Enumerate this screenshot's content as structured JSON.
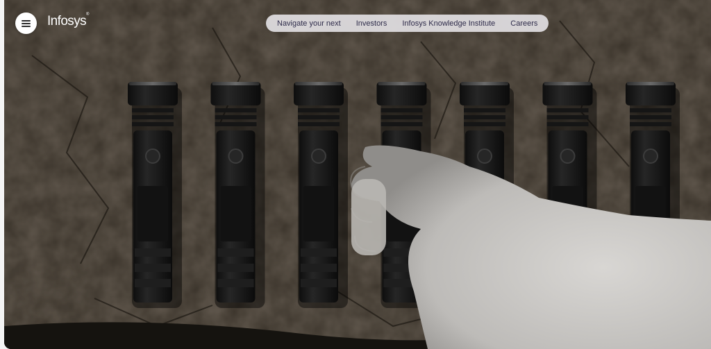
{
  "brand": {
    "logo_text": "Infosys",
    "logo_mark": "®"
  },
  "header": {
    "menu_icon": "hamburger-icon",
    "nav": [
      {
        "label": "Navigate your next"
      },
      {
        "label": "Investors"
      },
      {
        "label": "Infosys Knowledge Institute"
      },
      {
        "label": "Careers"
      }
    ]
  },
  "hero": {
    "image_subject": "flashlights-with-furry-hand",
    "flashlight_count": 7,
    "colors": {
      "stone": "#3d362d",
      "flashlight": "#1a1a1a",
      "fur": "#c9c7c4",
      "nav_text": "#2e2b4a",
      "nav_bg": "#e2dfe3"
    }
  }
}
